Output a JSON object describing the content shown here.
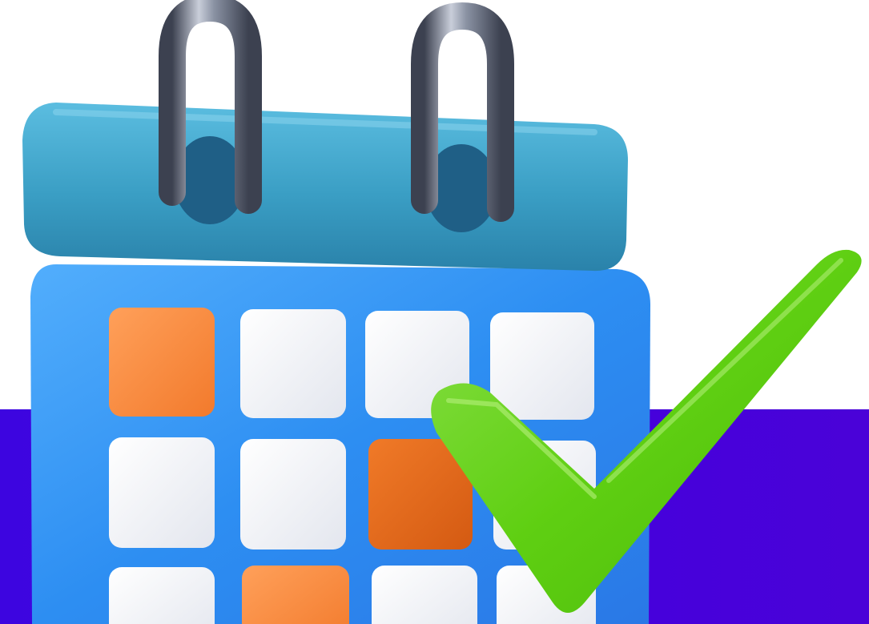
{
  "scene": {
    "subject": "calendar-with-checkmark",
    "colors": {
      "background": "#ffffff",
      "band": "#4400dd",
      "calendar_header": "#3fa6c8",
      "calendar_body": "#2f8ff0",
      "tile_white": "#f3f4f8",
      "tile_orange": "#f08a3c",
      "tile_orange_dark": "#e06a1a",
      "ring_metal": "#7c8493",
      "checkmark": "#63d21a"
    },
    "calendar_grid": {
      "rows": 3,
      "columns": 4,
      "highlighted": [
        "row1-col1",
        "row2-col3",
        "row3-col2"
      ]
    }
  }
}
